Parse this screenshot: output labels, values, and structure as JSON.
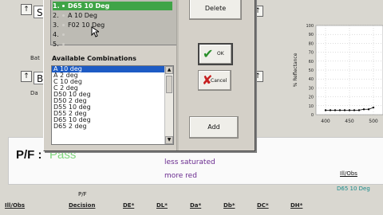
{
  "dialog": {
    "selected_list": [
      {
        "num": "1.",
        "label": "D65 10 Deg",
        "selected": true
      },
      {
        "num": "2.",
        "label": "A 10 Deg",
        "selected": false
      },
      {
        "num": "3.",
        "label": "F02 10 Deg",
        "selected": false
      },
      {
        "num": "4.",
        "label": "",
        "selected": false
      },
      {
        "num": "5.",
        "label": "",
        "selected": false
      }
    ],
    "available_title": "Available Combinations",
    "available": [
      "A 10 deg",
      "A 2 deg",
      "C 10 deg",
      "C 2 deg",
      "D50 10 deg",
      "D50 2 deg",
      "D55 10 deg",
      "D55 2 deg",
      "D65 10 deg",
      "D65 2 deg"
    ],
    "buttons": {
      "delete": "Delete",
      "ok": "OK",
      "cancel": "Cancel",
      "add": "Add"
    }
  },
  "background": {
    "field1": "S",
    "field2": "B",
    "label_bat": "Bat",
    "label_da": "Da",
    "pf_label": "P/F :",
    "pf_value": "Pass",
    "msg1": "less saturated",
    "msg2": "more red",
    "ill_obs_label": "Ill/Obs",
    "ill_obs_value": "D65 10 Deg",
    "pf_small": "P/F",
    "headers": [
      "Ill/Obs",
      "Decision",
      "DE*",
      "DL*",
      "Da*",
      "Db*",
      "DC*",
      "DH*"
    ]
  },
  "chart_data": {
    "type": "line",
    "ylabel": "% Reflectance",
    "x_ticks": [
      "400",
      "450",
      "500"
    ],
    "y_ticks": [
      "100",
      "90",
      "80",
      "70",
      "60",
      "50",
      "40",
      "30",
      "20",
      "10",
      "0"
    ],
    "series": [
      {
        "x": [
          400,
          410,
          420,
          430,
          440,
          450,
          460,
          470,
          480,
          490,
          500
        ],
        "y": [
          5,
          5,
          5,
          5,
          5,
          5,
          5,
          5,
          6,
          6,
          8
        ]
      }
    ],
    "xlim": [
      380,
      520
    ],
    "ylim": [
      0,
      100
    ]
  }
}
